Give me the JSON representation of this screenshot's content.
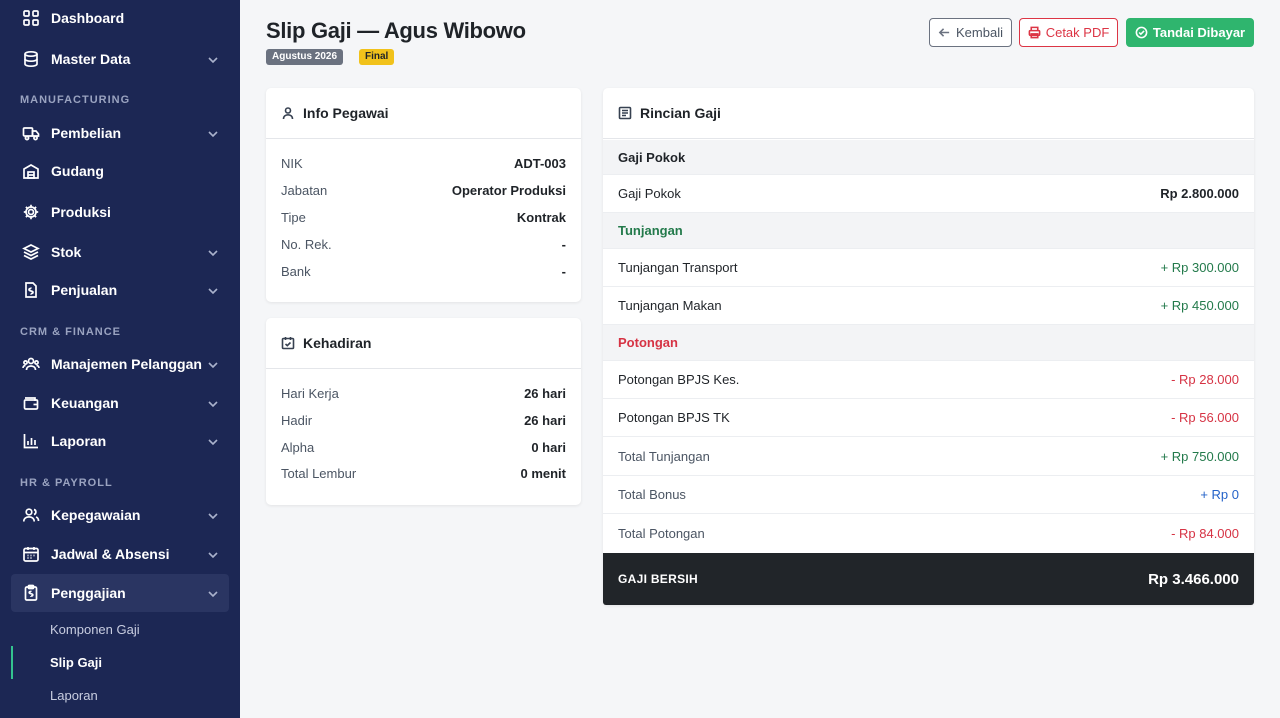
{
  "sidebar": {
    "items": {
      "dashboard": {
        "label": "Dashboard"
      },
      "master_data": {
        "label": "Master Data"
      },
      "pembelian": {
        "label": "Pembelian"
      },
      "gudang": {
        "label": "Gudang"
      },
      "produksi": {
        "label": "Produksi"
      },
      "stok": {
        "label": "Stok"
      },
      "penjualan": {
        "label": "Penjualan"
      },
      "manajemen_pelanggan": {
        "label": "Manajemen Pelanggan"
      },
      "keuangan": {
        "label": "Keuangan"
      },
      "laporan": {
        "label": "Laporan"
      },
      "kepegawaian": {
        "label": "Kepegawaian"
      },
      "jadwal_absensi": {
        "label": "Jadwal & Absensi"
      },
      "penggajian": {
        "label": "Penggajian"
      }
    },
    "sections": {
      "manufacturing": "MANUFACTURING",
      "crm_finance": "CRM & FINANCE",
      "hr_payroll": "HR & PAYROLL"
    },
    "subitems": {
      "komponen_gaji": "Komponen Gaji",
      "slip_gaji": "Slip Gaji",
      "laporan": "Laporan"
    }
  },
  "header": {
    "title": "Slip Gaji — Agus Wibowo",
    "period_badge": "Agustus 2026",
    "status_badge": "Final",
    "back_label": "Kembali",
    "pdf_label": "Cetak PDF",
    "paid_label": "Tandai Dibayar"
  },
  "info_pegawai": {
    "title": "Info Pegawai",
    "rows": [
      {
        "label": "NIK",
        "value": "ADT-003"
      },
      {
        "label": "Jabatan",
        "value": "Operator Produksi"
      },
      {
        "label": "Tipe",
        "value": "Kontrak"
      },
      {
        "label": "No. Rek.",
        "value": "-"
      },
      {
        "label": "Bank",
        "value": "-"
      }
    ]
  },
  "kehadiran": {
    "title": "Kehadiran",
    "rows": [
      {
        "label": "Hari Kerja",
        "value": "26 hari"
      },
      {
        "label": "Hadir",
        "value": "26 hari"
      },
      {
        "label": "Alpha",
        "value": "0 hari"
      },
      {
        "label": "Total Lembur",
        "value": "0 menit"
      }
    ]
  },
  "rincian": {
    "title": "Rincian Gaji",
    "gaji_pokok_section": "Gaji Pokok",
    "gaji_pokok_label": "Gaji Pokok",
    "gaji_pokok_value": "Rp 2.800.000",
    "tunjangan_section": "Tunjangan",
    "tunjangan": [
      {
        "label": "Tunjangan Transport",
        "value": "+ Rp 300.000"
      },
      {
        "label": "Tunjangan Makan",
        "value": "+ Rp 450.000"
      }
    ],
    "potongan_section": "Potongan",
    "potongan": [
      {
        "label": "Potongan BPJS Kes.",
        "value": "- Rp 28.000"
      },
      {
        "label": "Potongan BPJS TK",
        "value": "- Rp 56.000"
      }
    ],
    "total_tunjangan_label": "Total Tunjangan",
    "total_tunjangan_value": "+ Rp 750.000",
    "total_bonus_label": "Total Bonus",
    "total_bonus_value": "+ Rp 0",
    "total_potongan_label": "Total Potongan",
    "total_potongan_value": "- Rp 84.000",
    "net_label": "GAJI BERSIH",
    "net_value": "Rp 3.466.000"
  },
  "colors": {
    "sidebar_bg": "#1c2754",
    "accent_green": "#2fb56e",
    "danger_red": "#dc3545",
    "net_bg": "#212529"
  }
}
